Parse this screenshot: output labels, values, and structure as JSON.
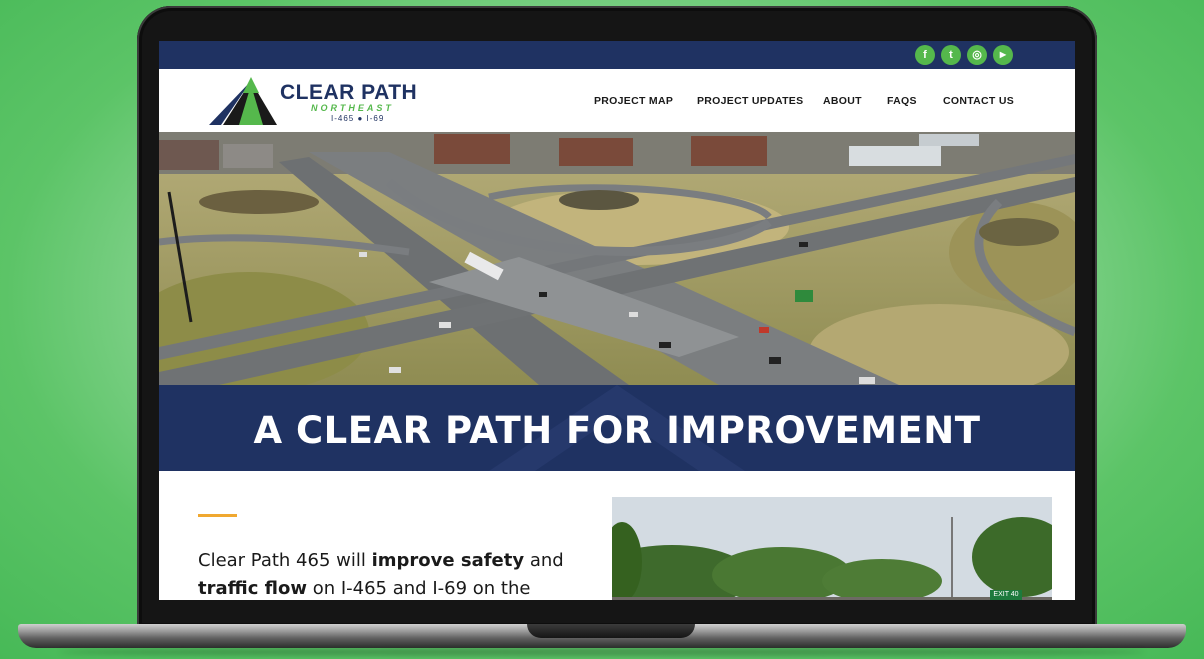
{
  "social": {
    "icons": [
      "facebook-icon",
      "twitter-icon",
      "instagram-icon",
      "youtube-icon"
    ],
    "glyphs": [
      "f",
      "t",
      "◎",
      "▶"
    ]
  },
  "logo": {
    "title": "CLEAR PATH",
    "subtitle": "NORTHEAST",
    "routes": "I-465 ● I-69"
  },
  "nav": {
    "items": [
      "PROJECT MAP",
      "PROJECT UPDATES",
      "ABOUT",
      "FAQS",
      "CONTACT US"
    ]
  },
  "banner": {
    "title": "A CLEAR PATH FOR IMPROVEMENT"
  },
  "intro": {
    "part1": "Clear Path 465 will ",
    "bold1": "improve safety",
    "part2": " and ",
    "bold2": "traffic flow",
    "part3": " on I-465 and I-69 on the"
  },
  "photo2": {
    "sign_text": "EXIT 40"
  },
  "colors": {
    "navy": "#1f3262",
    "green": "#55b84c",
    "accent": "#f0a830"
  }
}
